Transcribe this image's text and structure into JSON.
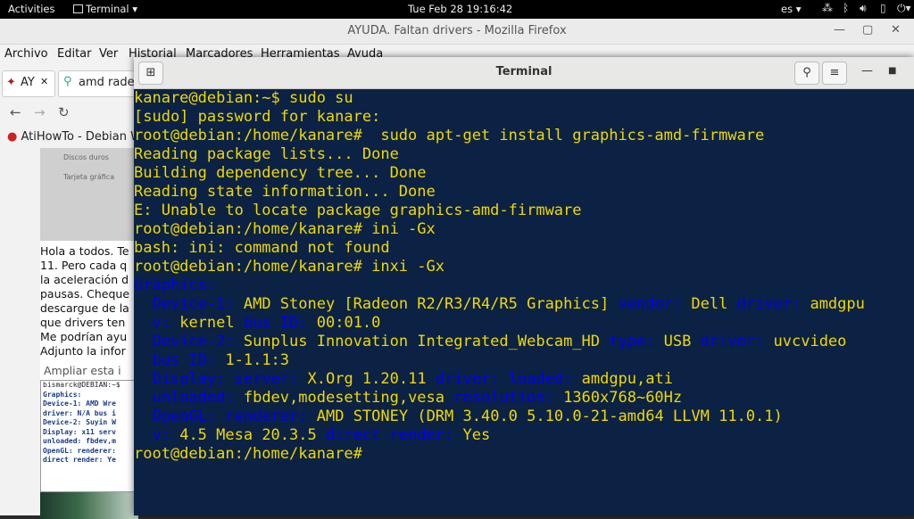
{
  "topbar": {
    "activities": "Activities",
    "app_menu": "Terminal",
    "clock": "Tue Feb 28  19:16:42",
    "lang": "es"
  },
  "firefox": {
    "window_title": "AYUDA. Faltan drivers - Mozilla Firefox",
    "menu": [
      "Archivo",
      "Editar",
      "Ver",
      "Historial",
      "Marcadores",
      "Herramientas",
      "Ayuda"
    ],
    "tab1_label": "AY",
    "tab2_label": "amd rade",
    "bookmark": "AtiHowTo - Debian W",
    "page_image_labels": [
      "Discos duros",
      "Tarjeta gráfica"
    ],
    "page_text": [
      "Hola a todos. Te",
      "11. Pero cada q",
      "la aceleración d",
      "pausas. Cheque",
      "descargue de la",
      "que drivers ten",
      "Me podrían ayu",
      "Adjunto la infor"
    ],
    "ampliar": "Ampliar esta i",
    "thumb_lines": [
      "bismarck@DEBIAN:~$",
      "Graphics:",
      "  Device-1: AMD Wre",
      "  driver: N/A bus i",
      "  Device-2: Suyin W",
      "  Display: x11 serv",
      "  unloaded: fbdev,m",
      "  OpenGL: renderer:",
      "  direct render: Ye"
    ]
  },
  "terminal": {
    "title": "Terminal",
    "lines": [
      [
        {
          "t": "kanare@debian:~$ sudo su",
          "k": false
        }
      ],
      [
        {
          "t": "[sudo] password for kanare:",
          "k": false
        }
      ],
      [
        {
          "t": "root@debian:/home/kanare#  sudo apt-get install graphics-amd-firmware",
          "k": false
        }
      ],
      [
        {
          "t": "Reading package lists... Done",
          "k": false
        }
      ],
      [
        {
          "t": "Building dependency tree... Done",
          "k": false
        }
      ],
      [
        {
          "t": "Reading state information... Done",
          "k": false
        }
      ],
      [
        {
          "t": "E: Unable to locate package graphics-amd-firmware",
          "k": false
        }
      ],
      [
        {
          "t": "root@debian:/home/kanare# ini -Gx",
          "k": false
        }
      ],
      [
        {
          "t": "bash: ini: command not found",
          "k": false
        }
      ],
      [
        {
          "t": "root@debian:/home/kanare# inxi -Gx",
          "k": false
        }
      ],
      [
        {
          "t": "Graphics:",
          "k": true
        }
      ],
      [
        {
          "t": "  ",
          "k": false
        },
        {
          "t": "Device-1:",
          "k": true
        },
        {
          "t": " AMD Stoney [Radeon R2/R3/R4/R5 Graphics] ",
          "k": false
        },
        {
          "t": "vendor:",
          "k": true
        },
        {
          "t": " Dell ",
          "k": false
        },
        {
          "t": "driver:",
          "k": true
        },
        {
          "t": " amdgpu",
          "k": false
        }
      ],
      [
        {
          "t": "  ",
          "k": false
        },
        {
          "t": "v:",
          "k": true
        },
        {
          "t": " kernel ",
          "k": false
        },
        {
          "t": "bus ID:",
          "k": true
        },
        {
          "t": " 00:01.0",
          "k": false
        }
      ],
      [
        {
          "t": "  ",
          "k": false
        },
        {
          "t": "Device-2:",
          "k": true
        },
        {
          "t": " Sunplus Innovation Integrated_Webcam_HD ",
          "k": false
        },
        {
          "t": "type:",
          "k": true
        },
        {
          "t": " USB ",
          "k": false
        },
        {
          "t": "driver:",
          "k": true
        },
        {
          "t": " uvcvideo",
          "k": false
        }
      ],
      [
        {
          "t": "  ",
          "k": false
        },
        {
          "t": "bus ID:",
          "k": true
        },
        {
          "t": " 1-1.1:3",
          "k": false
        }
      ],
      [
        {
          "t": "  ",
          "k": false
        },
        {
          "t": "Display:",
          "k": true
        },
        {
          "t": " ",
          "k": false
        },
        {
          "t": "server:",
          "k": true
        },
        {
          "t": " X.Org 1.20.11 ",
          "k": false
        },
        {
          "t": "driver:",
          "k": true
        },
        {
          "t": " ",
          "k": false
        },
        {
          "t": "loaded:",
          "k": true
        },
        {
          "t": " amdgpu,ati",
          "k": false
        }
      ],
      [
        {
          "t": "  ",
          "k": false
        },
        {
          "t": "unloaded:",
          "k": true
        },
        {
          "t": " fbdev,modesetting,vesa ",
          "k": false
        },
        {
          "t": "resolution:",
          "k": true
        },
        {
          "t": " 1360x768~60Hz",
          "k": false
        }
      ],
      [
        {
          "t": "  ",
          "k": false
        },
        {
          "t": "OpenGL:",
          "k": true
        },
        {
          "t": " ",
          "k": false
        },
        {
          "t": "renderer:",
          "k": true
        },
        {
          "t": " AMD STONEY (DRM 3.40.0 5.10.0-21-amd64 LLVM 11.0.1)",
          "k": false
        }
      ],
      [
        {
          "t": "  ",
          "k": false
        },
        {
          "t": "v:",
          "k": true
        },
        {
          "t": " 4.5 Mesa 20.3.5 ",
          "k": false
        },
        {
          "t": "direct render:",
          "k": true
        },
        {
          "t": " Yes",
          "k": false
        }
      ],
      [
        {
          "t": "root@debian:/home/kanare#",
          "k": false
        }
      ]
    ]
  },
  "colors": {
    "terminal_bg": "#0b2244",
    "terminal_text": "#f0d800",
    "terminal_key": "#0000ee"
  },
  "icons": [
    "terminal-app-icon",
    "network-icon",
    "bluetooth-icon",
    "volume-icon",
    "battery-icon",
    "power-icon",
    "new-tab-icon",
    "search-icon",
    "hamburger-menu-icon",
    "minimize-icon",
    "maximize-icon",
    "close-icon"
  ]
}
